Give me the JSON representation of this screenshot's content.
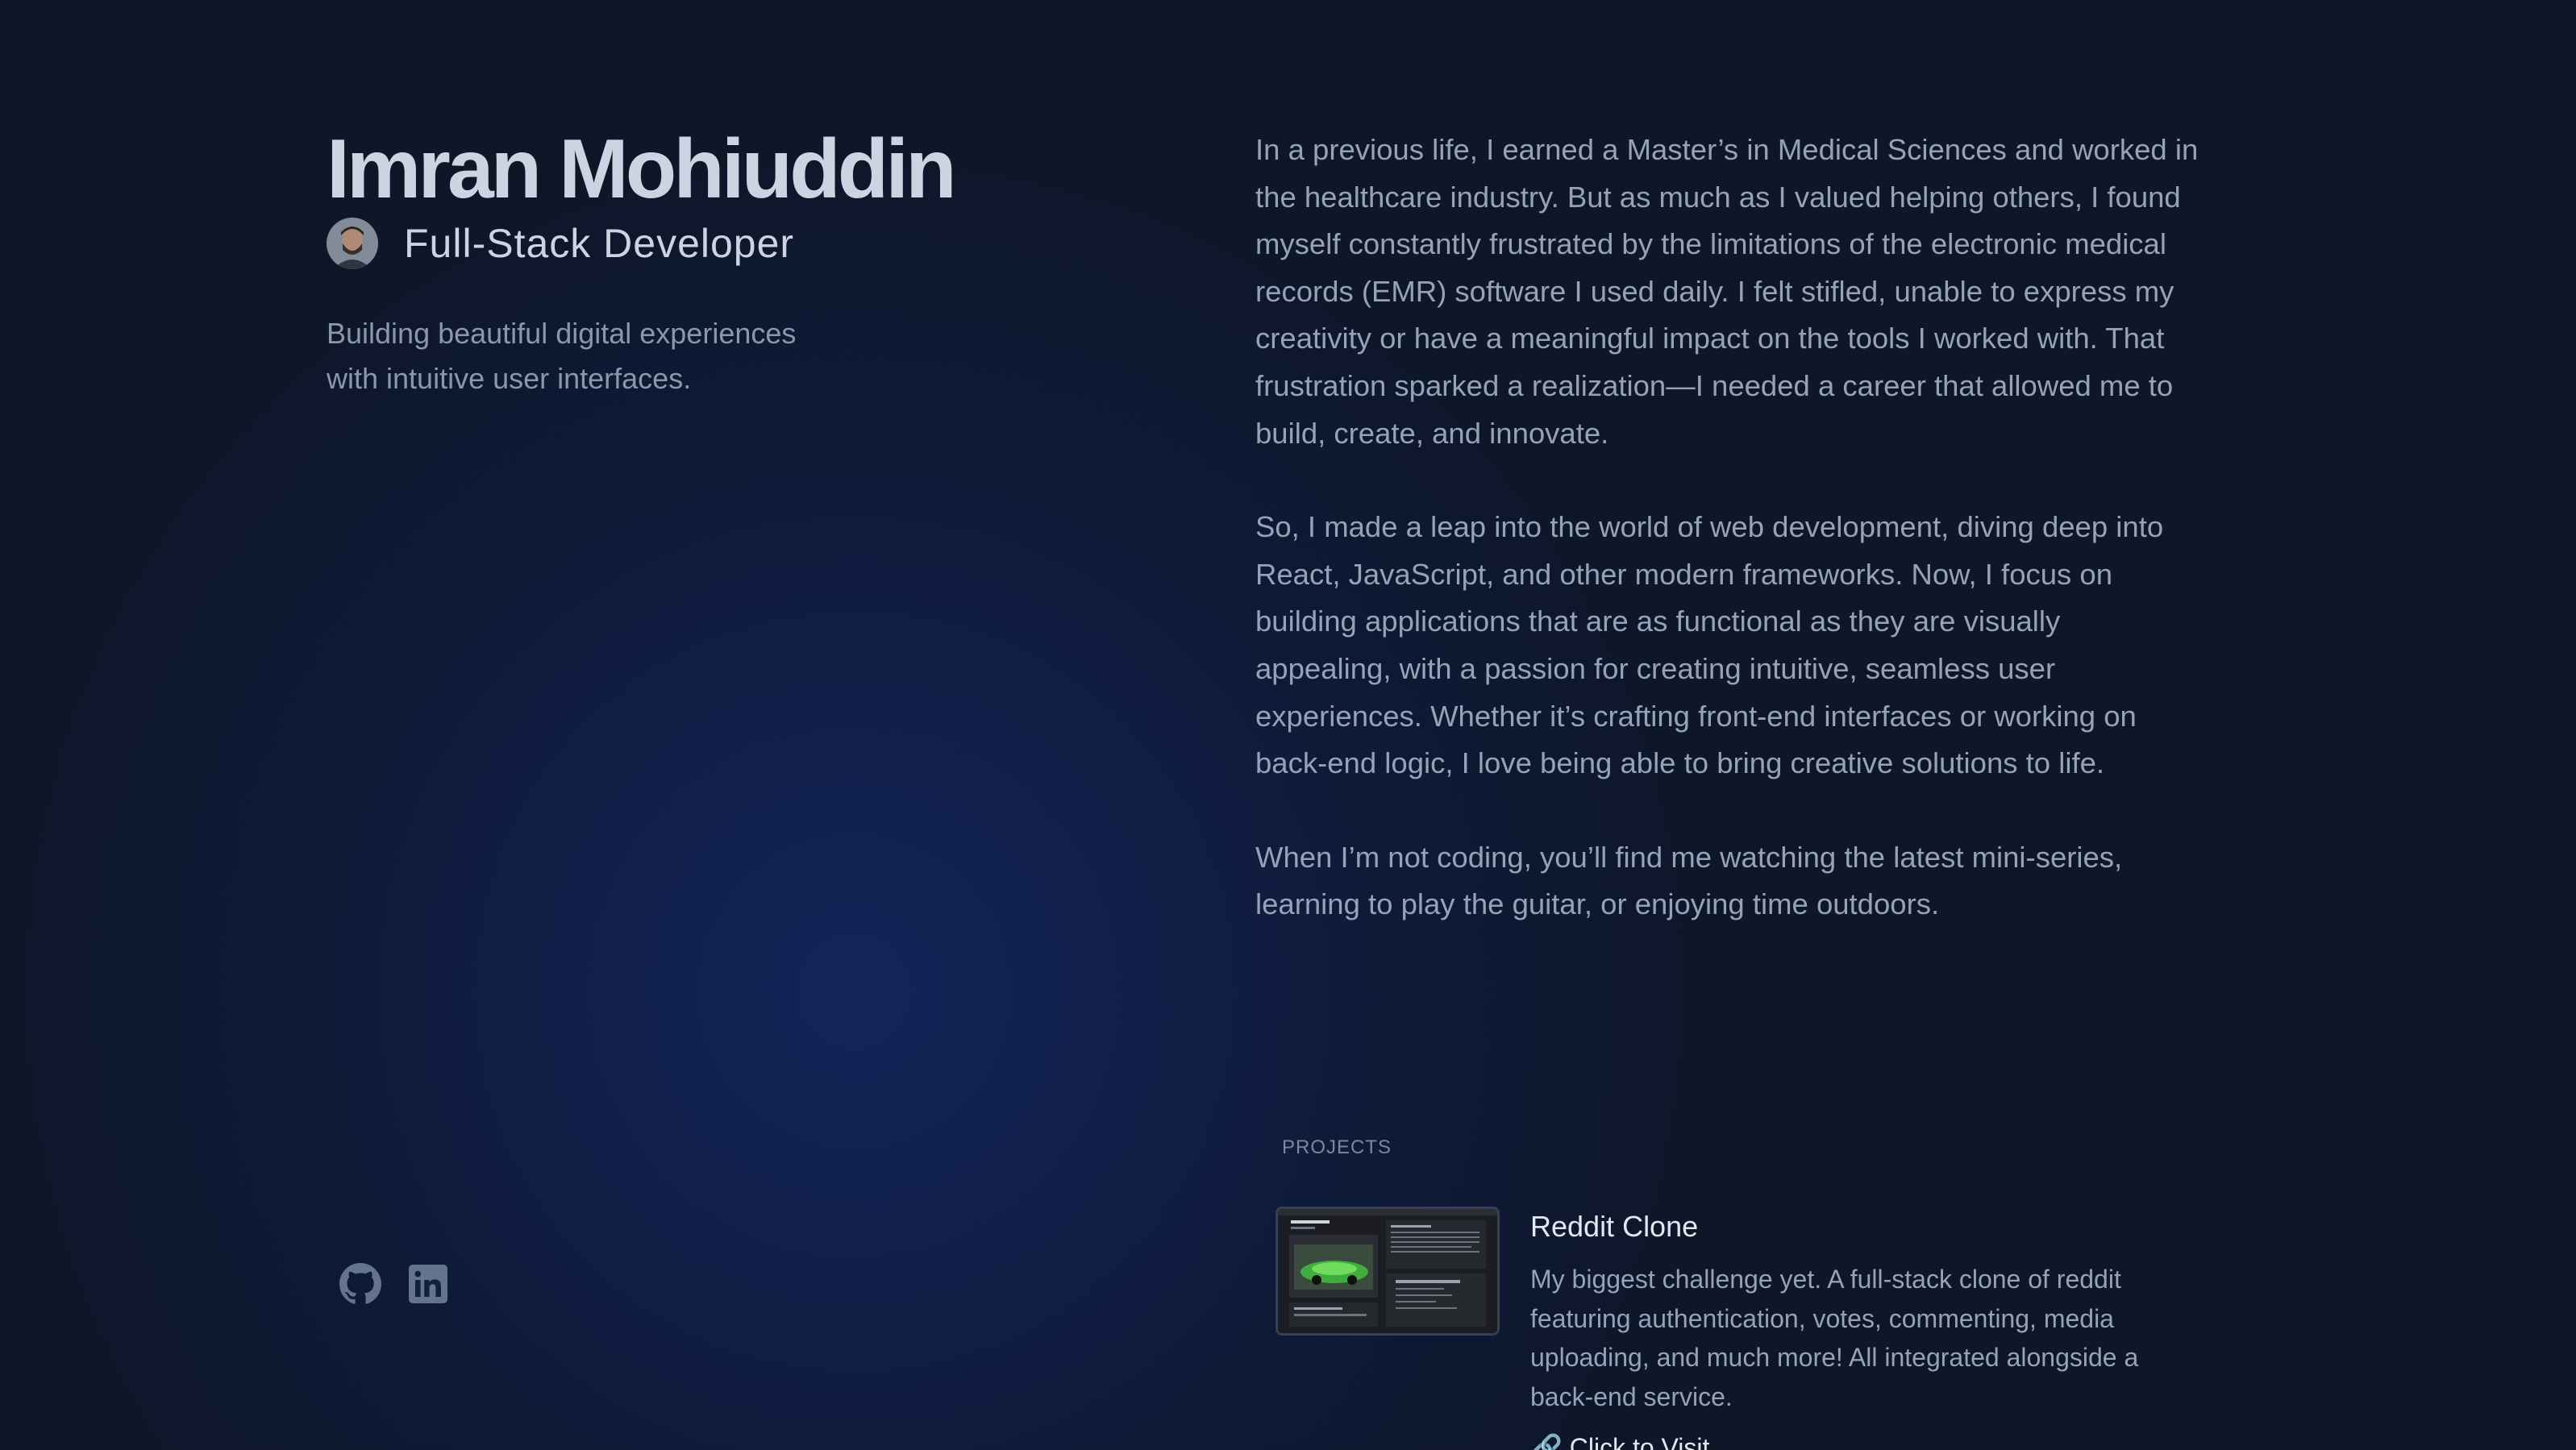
{
  "header": {
    "name": "Imran Mohiuddin",
    "role": "Full-Stack Developer",
    "tagline": "Building beautiful digital experiences with intuitive user interfaces."
  },
  "socials": [
    {
      "icon": "github-icon"
    },
    {
      "icon": "linkedin-icon"
    }
  ],
  "about": {
    "paragraphs": [
      "In a previous life, I earned a Master’s in Medical Sciences and worked in the healthcare industry. But as much as I valued helping others, I found myself constantly frustrated by the limitations of the electronic medical records (EMR) software I used daily. I felt stifled, unable to express my creativity or have a meaningful impact on the tools I worked with. That frustration sparked a realization—I needed a career that allowed me to build, create, and innovate.",
      "So, I made a leap into the world of web development, diving deep into React, JavaScript, and other modern frameworks. Now, I focus on building applications that are as functional as they are visually appealing, with a passion for creating intuitive, seamless user experiences. Whether it’s crafting front-end interfaces or working on back-end logic, I love being able to bring creative solutions to life.",
      "When I’m not coding, you’ll find me watching the latest mini-series, learning to play the guitar, or enjoying time outdoors."
    ]
  },
  "projects": {
    "label": "PROJECTS",
    "items": [
      {
        "title": "Reddit Clone",
        "description": "My biggest challenge yet. A full-stack clone of reddit featuring authentication, votes, commenting, media uploading, and much more! All integrated alongside a back-end service.",
        "link_label": "Click to Visit"
      }
    ]
  },
  "colors": {
    "background": "#0f172a",
    "heading": "#cbd5e1",
    "body": "#94a3b8"
  }
}
